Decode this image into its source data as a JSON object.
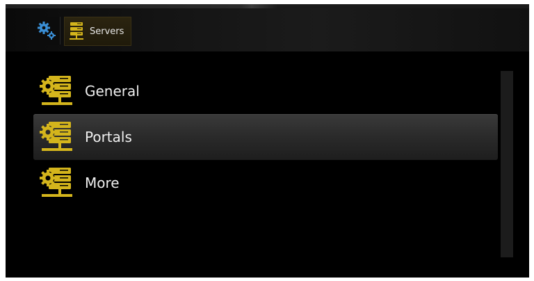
{
  "header": {
    "gear_icon": "gears-icon",
    "active_tab": {
      "icon": "server-stack-icon",
      "label": "Servers"
    }
  },
  "menu": {
    "items": [
      {
        "label": "General",
        "icon": "server-gear-icon",
        "selected": false
      },
      {
        "label": "Portals",
        "icon": "server-gear-icon",
        "selected": true
      },
      {
        "label": "More",
        "icon": "server-gear-icon",
        "selected": false
      }
    ]
  },
  "colors": {
    "accent_yellow": "#d4b51c",
    "gear_blue": "#3a8fd6",
    "background": "#000000",
    "selection": "#2e2e2e",
    "text": "#f0f0f0"
  }
}
